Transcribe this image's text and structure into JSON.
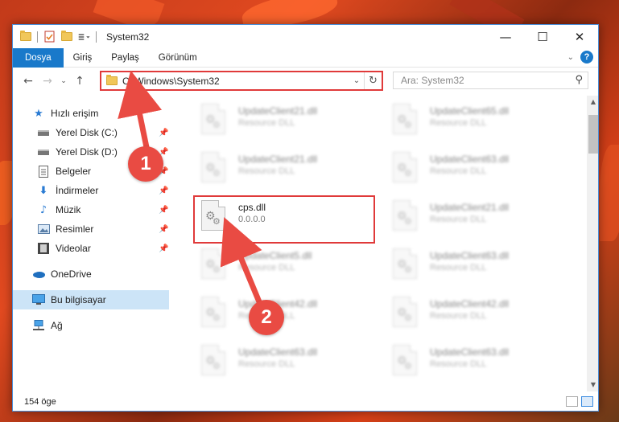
{
  "window": {
    "title": "System32",
    "controls": {
      "minimize": "—",
      "maximize": "☐",
      "close": "✕"
    }
  },
  "ribbon": {
    "tabs": [
      "Dosya",
      "Giriş",
      "Paylaş",
      "Görünüm"
    ],
    "help": "?"
  },
  "navigation": {
    "address_path": "C:\\Windows\\System32",
    "search_placeholder": "Ara: System32"
  },
  "sidebar": {
    "items": [
      {
        "label": "Hızlı erişim",
        "icon": "star-icon"
      },
      {
        "label": "Yerel Disk (C:)",
        "icon": "drive-icon",
        "pinned": true
      },
      {
        "label": "Yerel Disk (D:)",
        "icon": "drive-icon",
        "pinned": true
      },
      {
        "label": "Belgeler",
        "icon": "document-icon",
        "pinned": true
      },
      {
        "label": "İndirmeler",
        "icon": "download-icon",
        "pinned": true
      },
      {
        "label": "Müzik",
        "icon": "music-icon",
        "pinned": true
      },
      {
        "label": "Resimler",
        "icon": "pictures-icon",
        "pinned": true
      },
      {
        "label": "Videolar",
        "icon": "video-icon",
        "pinned": true
      },
      {
        "label": "OneDrive",
        "icon": "cloud-icon"
      },
      {
        "label": "Bu bilgisayar",
        "icon": "computer-icon",
        "selected": true
      },
      {
        "label": "Ağ",
        "icon": "network-icon"
      }
    ]
  },
  "files": [
    {
      "name": "UpdateClient21.dll",
      "desc": "Resource DLL"
    },
    {
      "name": "UpdateClient65.dll",
      "desc": "Resource DLL"
    },
    {
      "name": "UpdateClient21.dll",
      "desc": "Resource DLL"
    },
    {
      "name": "UpdateClient63.dll",
      "desc": "Resource DLL"
    },
    {
      "name": "cps.dll",
      "desc": "0.0.0.0",
      "highlighted": true
    },
    {
      "name": "UpdateClient21.dll",
      "desc": "Resource DLL"
    },
    {
      "name": "UpdateClient5.dll",
      "desc": "Resource DLL"
    },
    {
      "name": "UpdateClient63.dll",
      "desc": "Resource DLL"
    },
    {
      "name": "UpdateClient42.dll",
      "desc": "Resource DLL"
    },
    {
      "name": "UpdateClient42.dll",
      "desc": "Resource DLL"
    },
    {
      "name": "UpdateClient63.dll",
      "desc": "Resource DLL"
    },
    {
      "name": "UpdateClient63.dll",
      "desc": "Resource DLL"
    }
  ],
  "status": {
    "item_count": "154 öge"
  },
  "annotations": {
    "step1": "1",
    "step2": "2",
    "color": "#e94b43"
  }
}
